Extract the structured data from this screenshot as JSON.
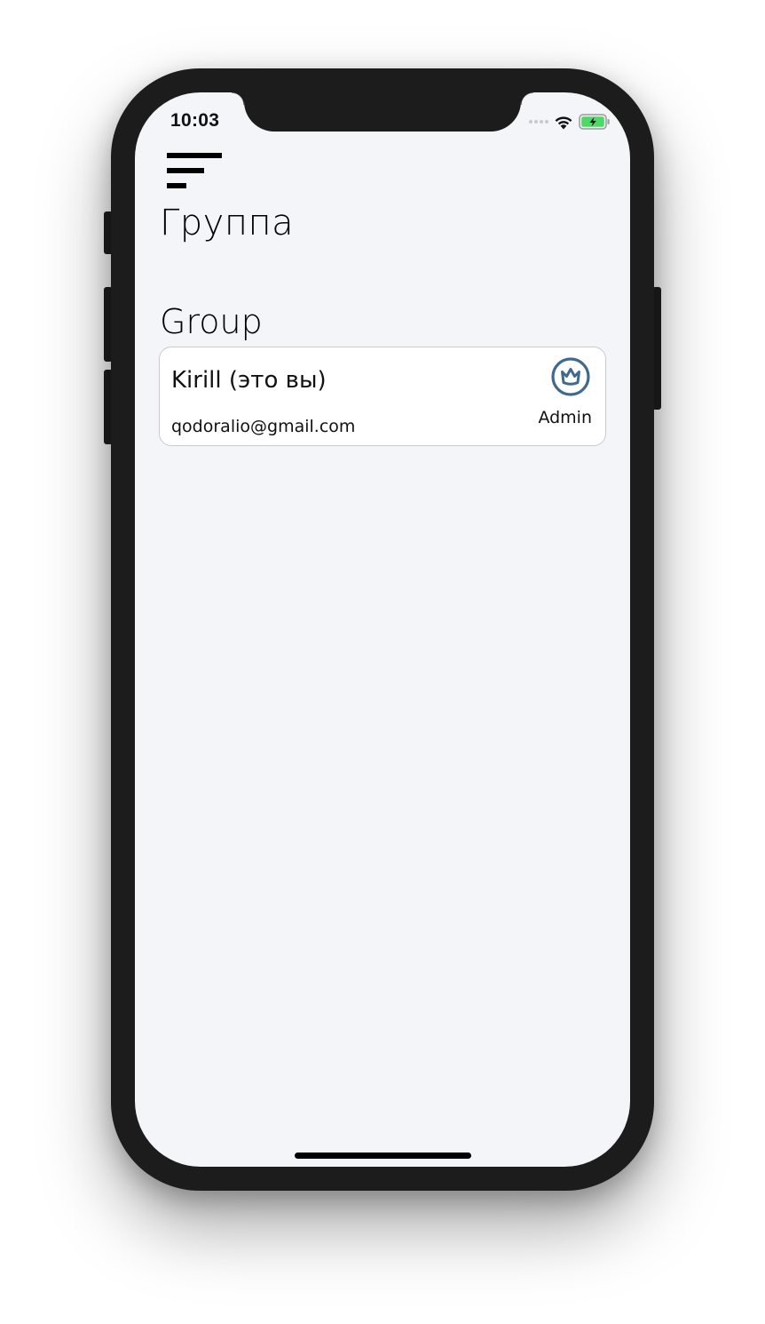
{
  "status_bar": {
    "time": "10:03",
    "icons": [
      "signal-dots-icon",
      "wifi-icon",
      "battery-charging-icon"
    ],
    "battery_color": "#4cd964"
  },
  "header": {
    "menu_icon": "menu-icon",
    "title": "Группа"
  },
  "group": {
    "section_title": "Group",
    "members": [
      {
        "name": "Kirill (это вы)",
        "email": "qodoralio@gmail.com",
        "role": "Admin",
        "role_icon": "crown-icon",
        "role_icon_color": "#3f6a8f"
      }
    ]
  },
  "colors": {
    "background": "#f4f5f9",
    "card": "#ffffff",
    "card_border": "#c8cad2",
    "accent": "#3f6a8f"
  }
}
